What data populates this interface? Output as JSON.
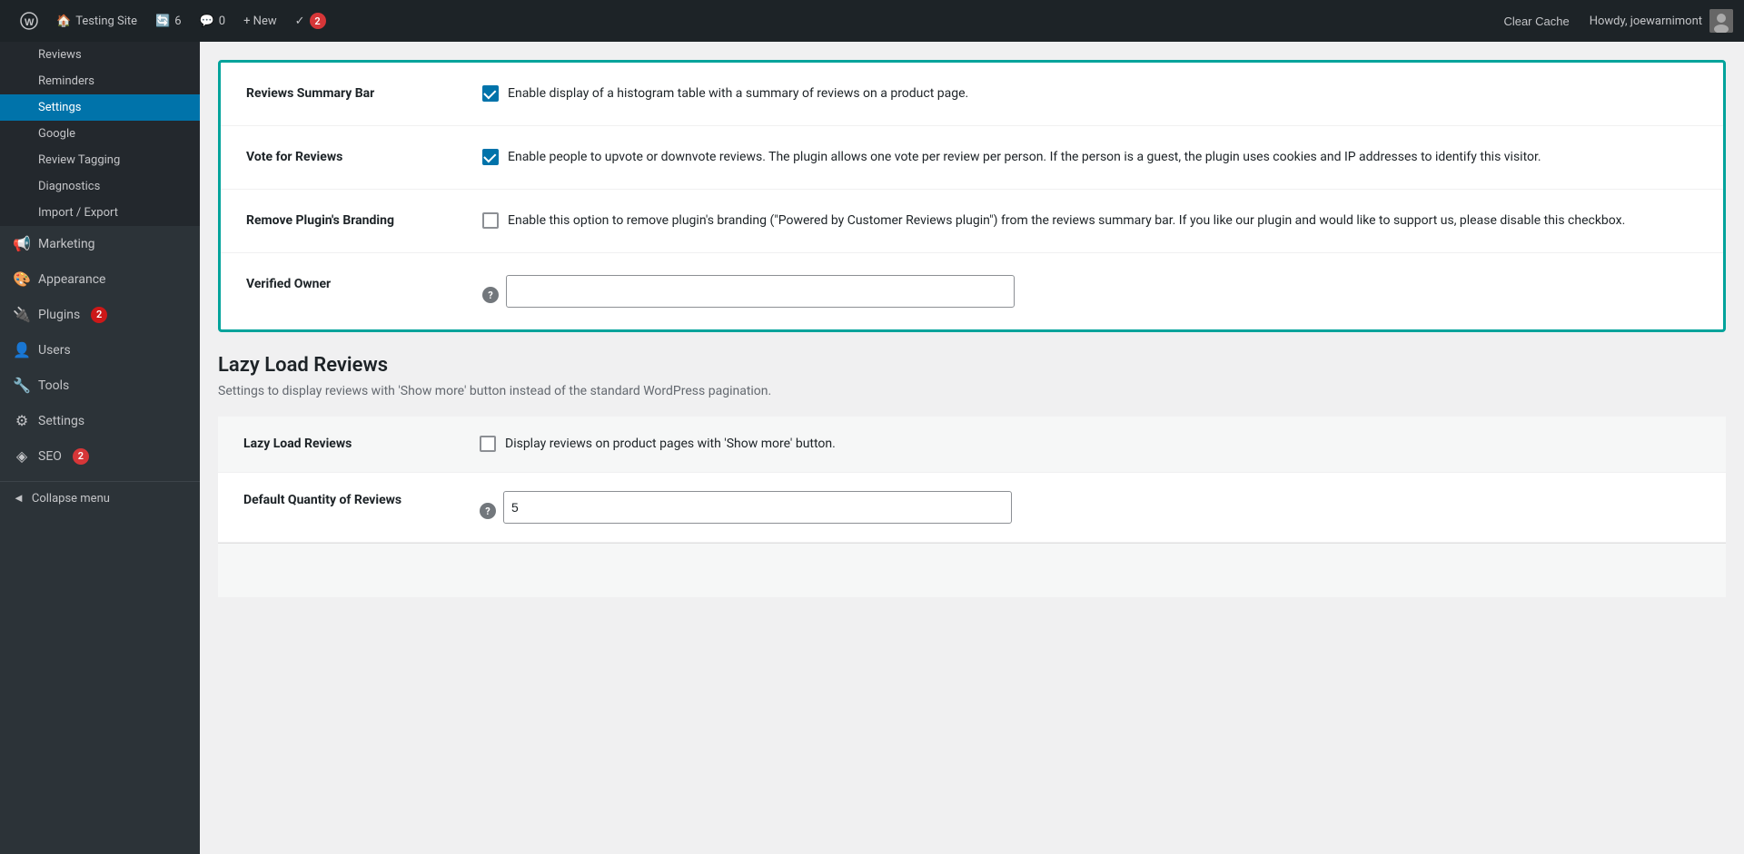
{
  "topbar": {
    "wp_logo": "W",
    "site_name": "Testing Site",
    "updates_count": "6",
    "comments_count": "0",
    "new_label": "+ New",
    "plugin_icon": "✓",
    "plugin_badge": "2",
    "clear_cache": "Clear Cache",
    "howdy": "Howdy, joewarnimont"
  },
  "sidebar": {
    "items": [
      {
        "id": "reviews",
        "label": "Reviews",
        "icon": "★",
        "active": false
      },
      {
        "id": "reminders",
        "label": "Reminders",
        "icon": "🔔",
        "active": false
      },
      {
        "id": "settings",
        "label": "Settings",
        "icon": "⚙",
        "active": true
      },
      {
        "id": "google",
        "label": "Google",
        "icon": "G",
        "active": false
      },
      {
        "id": "review-tagging",
        "label": "Review Tagging",
        "icon": "#",
        "active": false
      },
      {
        "id": "diagnostics",
        "label": "Diagnostics",
        "icon": "🔧",
        "active": false
      },
      {
        "id": "import-export",
        "label": "Import / Export",
        "icon": "↔",
        "active": false
      }
    ],
    "main_items": [
      {
        "id": "marketing",
        "label": "Marketing",
        "icon": "📢"
      },
      {
        "id": "appearance",
        "label": "Appearance",
        "icon": "🎨"
      },
      {
        "id": "plugins",
        "label": "Plugins",
        "icon": "🔌",
        "badge": "2"
      },
      {
        "id": "users",
        "label": "Users",
        "icon": "👤"
      },
      {
        "id": "tools",
        "label": "Tools",
        "icon": "🔧"
      },
      {
        "id": "wp-settings",
        "label": "Settings",
        "icon": "⚙"
      },
      {
        "id": "seo",
        "label": "SEO",
        "icon": "◈",
        "badge": "2"
      }
    ],
    "collapse": "Collapse menu"
  },
  "settings": {
    "box_rows": [
      {
        "id": "reviews-summary-bar",
        "label": "Reviews Summary Bar",
        "checked": true,
        "description": "Enable display of a histogram table with a summary of reviews on a product page."
      },
      {
        "id": "vote-for-reviews",
        "label": "Vote for Reviews",
        "checked": true,
        "description": "Enable people to upvote or downvote reviews. The plugin allows one vote per review per person. If the person is a guest, the plugin uses cookies and IP addresses to identify this visitor."
      },
      {
        "id": "remove-branding",
        "label": "Remove Plugin's Branding",
        "checked": false,
        "description": "Enable this option to remove plugin's branding (\"Powered by Customer Reviews plugin\") from the reviews summary bar. If you like our plugin and would like to support us, please disable this checkbox."
      },
      {
        "id": "verified-owner",
        "label": "Verified Owner",
        "type": "input",
        "value": "",
        "has_help": true
      }
    ]
  },
  "lazy_load": {
    "title": "Lazy Load Reviews",
    "description": "Settings to display reviews with 'Show more' button instead of the standard WordPress pagination.",
    "rows": [
      {
        "id": "lazy-load-reviews",
        "label": "Lazy Load Reviews",
        "checked": false,
        "description": "Display reviews on product pages with 'Show more' button."
      },
      {
        "id": "default-quantity",
        "label": "Default Quantity of Reviews",
        "type": "number",
        "value": "5",
        "has_help": true
      }
    ]
  }
}
